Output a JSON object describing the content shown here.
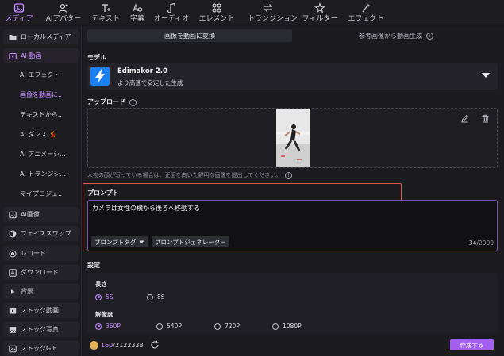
{
  "toolbar": {
    "items": [
      {
        "label": "メディア",
        "icon": "media-icon",
        "active": true
      },
      {
        "label": "AIアバター",
        "icon": "avatar-icon"
      },
      {
        "label": "テキスト",
        "icon": "text-icon"
      },
      {
        "label": "字幕",
        "icon": "caption-icon"
      },
      {
        "label": "オーディオ",
        "icon": "audio-icon"
      },
      {
        "label": "エレメント",
        "icon": "element-icon"
      },
      {
        "label": "トランジション",
        "icon": "transition-icon"
      },
      {
        "label": "フィルター",
        "icon": "filter-icon"
      },
      {
        "label": "エフェクト",
        "icon": "effect-icon"
      }
    ]
  },
  "sidebar": {
    "items": [
      {
        "label": "ローカルメディア",
        "icon": "folder-icon",
        "type": "group"
      },
      {
        "label": "AI 動画",
        "icon": "ai-video-icon",
        "type": "group-active"
      },
      {
        "label": "AI エフェクト",
        "type": "sub"
      },
      {
        "label": "画像を動画に...",
        "type": "sub-selected"
      },
      {
        "label": "テキストから...",
        "type": "sub"
      },
      {
        "label": "AI ダンス 💃",
        "type": "sub"
      },
      {
        "label": "AI アニメーシ...",
        "type": "sub"
      },
      {
        "label": "AI トランジシ...",
        "type": "sub"
      },
      {
        "label": "マイプロジェ...",
        "type": "sub"
      },
      {
        "label": "AI画像",
        "icon": "ai-image-icon",
        "type": "group"
      },
      {
        "label": "フェイススワップ",
        "icon": "face-swap-icon",
        "type": "group"
      },
      {
        "label": "レコード",
        "icon": "record-icon",
        "type": "group"
      },
      {
        "label": "ダウンロード",
        "icon": "download-icon",
        "type": "group"
      },
      {
        "label": "背景",
        "icon": "background-icon",
        "type": "group"
      },
      {
        "label": "ストック動画",
        "icon": "stock-video-icon",
        "type": "group"
      },
      {
        "label": "ストック写真",
        "icon": "stock-photo-icon",
        "type": "group"
      },
      {
        "label": "ストックGIF",
        "icon": "stock-gif-icon",
        "type": "group"
      }
    ]
  },
  "main": {
    "tabs": [
      {
        "label": "画像を動画に変換"
      },
      {
        "label": "参考画像から動画生成"
      }
    ],
    "model": {
      "section_title": "モデル",
      "name": "Edimakor 2.0",
      "description": "より高速で安定した生成"
    },
    "upload": {
      "section_title": "アップロード",
      "hint": "人物の顔が写っている場合は、正面を向いた鮮明な画像を提出してください。"
    },
    "prompt": {
      "section_title": "プロンプト",
      "value": "カメラは女性の横から後ろへ移動する",
      "tag_button": "プロンプトタグ",
      "generator_button": "プロンプトジェネレーター",
      "char_count": "34",
      "char_max": "/2000"
    },
    "settings": {
      "section_title": "設定",
      "length_label": "長さ",
      "length_options": [
        "5S",
        "8S"
      ],
      "length_selected": "5S",
      "resolution_label": "解像度",
      "resolution_options": [
        "360P",
        "540P",
        "720P",
        "1080P"
      ],
      "resolution_selected": "360P"
    },
    "footer": {
      "credits_used": "160",
      "credits_total": "/2122338",
      "create_button": "作成する"
    }
  },
  "colors": {
    "accent": "#c58cff",
    "create_button": "#a35ff0",
    "highlight_frame": "#e0564f",
    "model_logo": "#1a7ff0"
  }
}
